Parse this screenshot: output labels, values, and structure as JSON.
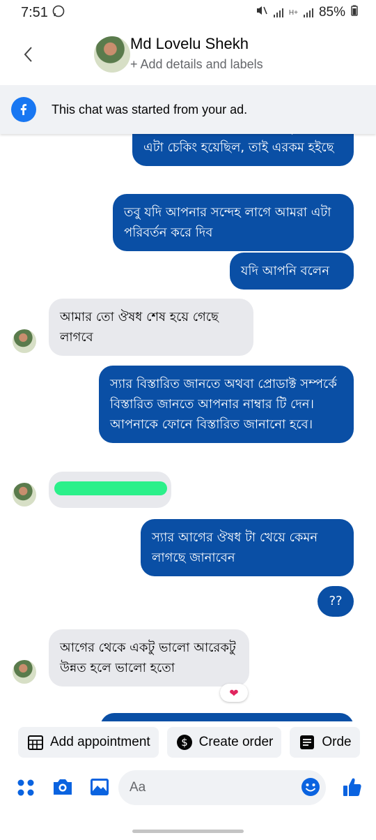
{
  "status_bar": {
    "time": "7:51",
    "battery": "85%",
    "network": "H+"
  },
  "header": {
    "contact_name": "Md Lovelu Shekh",
    "subtitle": "+ Add details and labels"
  },
  "ad_banner": {
    "text": "This chat was started from your ad."
  },
  "messages": [
    {
      "from": "page",
      "text": "স্যার প্রোডাক্ট টা ঠিক আছে। কুরিয়ারে এটা চেকিং হয়েছিল, তাই এরকম হইছে"
    },
    {
      "from": "page",
      "text": "তবু যদি আপনার সন্দেহ লাগে আমরা এটা পরিবর্তন করে দিব"
    },
    {
      "from": "page",
      "text": "যদি আপনি বলেন"
    },
    {
      "from": "customer",
      "text": "আমার তো ঔষধ শেষ হয়ে গেছে লাগবে"
    },
    {
      "from": "page",
      "text": "স্যার বিস্তারিত জানতে অথবা প্রোডাক্ট সম্পর্কে বিস্তারিত জানতে আপনার নাম্বার টি দেন।\nআপনাকে ফোনে বিস্তারিত জানানো হবে।"
    },
    {
      "from": "customer",
      "text": "[redacted]"
    },
    {
      "from": "page",
      "text": "স্যার আগের ঔষধ টা খেয়ে কেমন লাগছে জানাবেন"
    },
    {
      "from": "page",
      "text": "??"
    },
    {
      "from": "customer",
      "text": "আগের থেকে একটু ভালো আরেকটু উন্নত হলে ভালো হতো",
      "reaction": "❤"
    }
  ],
  "quick_actions": [
    {
      "label": "Add appointment",
      "icon": "calendar-icon"
    },
    {
      "label": "Create order",
      "icon": "dollar-icon"
    },
    {
      "label": "Orde",
      "icon": "receipt-icon"
    }
  ],
  "composer": {
    "placeholder": "Aa"
  }
}
